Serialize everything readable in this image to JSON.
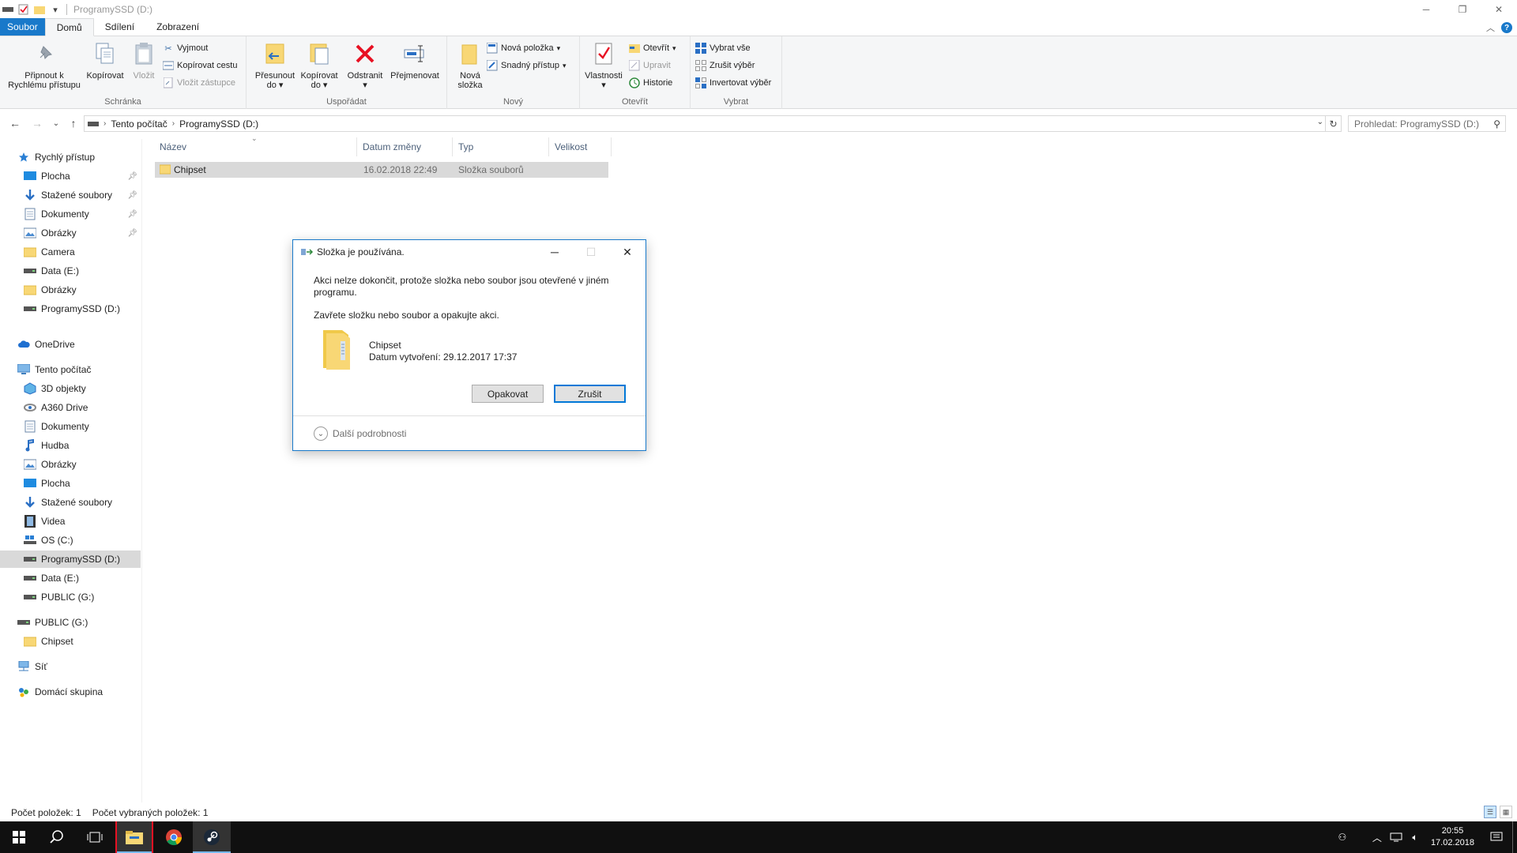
{
  "window": {
    "title": "ProgramySSD (D:)"
  },
  "tabs": [
    {
      "label": "Soubor"
    },
    {
      "label": "Domů"
    },
    {
      "label": "Sdílení"
    },
    {
      "label": "Zobrazení"
    }
  ],
  "ribbon": {
    "pin_label_1": "Připnout k",
    "pin_label_2": "Rychlému přístupu",
    "copy": "Kopírovat",
    "paste": "Vložit",
    "cut": "Vyjmout",
    "copy_path": "Kopírovat cestu",
    "paste_shortcut": "Vložit zástupce",
    "group_clipboard": "Schránka",
    "move_1": "Přesunout",
    "move_2": "do",
    "copyto_1": "Kopírovat",
    "copyto_2": "do",
    "delete": "Odstranit",
    "rename": "Přejmenovat",
    "group_organize": "Uspořádat",
    "newfolder_1": "Nová",
    "newfolder_2": "složka",
    "new_item": "Nová položka",
    "easy_access": "Snadný přístup",
    "group_new": "Nový",
    "properties": "Vlastnosti",
    "open": "Otevřít",
    "edit": "Upravit",
    "history": "Historie",
    "group_open": "Otevřít",
    "select_all": "Vybrat vše",
    "select_none": "Zrušit výběr",
    "invert": "Invertovat výběr",
    "group_select": "Vybrat"
  },
  "address": {
    "crumbs": [
      "Tento počítač",
      "ProgramySSD (D:)"
    ],
    "search_placeholder": "Prohledat: ProgramySSD (D:)"
  },
  "nav": {
    "quick_access": "Rychlý přístup",
    "qa_items": [
      "Plocha",
      "Stažené soubory",
      "Dokumenty",
      "Obrázky",
      "Camera",
      "Data (E:)",
      "Obrázky",
      "ProgramySSD (D:)"
    ],
    "onedrive": "OneDrive",
    "this_pc": "Tento počítač",
    "pc_items": [
      "3D objekty",
      "A360 Drive",
      "Dokumenty",
      "Hudba",
      "Obrázky",
      "Plocha",
      "Stažené soubory",
      "Videa",
      "OS (C:)",
      "ProgramySSD (D:)",
      "Data (E:)",
      "PUBLIC (G:)"
    ],
    "public": "PUBLIC (G:)",
    "public_items": [
      "Chipset"
    ],
    "network": "Síť",
    "homegroup": "Domácí skupina"
  },
  "columns": [
    "Název",
    "Datum změny",
    "Typ",
    "Velikost"
  ],
  "rows": [
    {
      "name": "Chipset",
      "date": "16.02.2018 22:49",
      "type": "Složka souborů",
      "size": ""
    }
  ],
  "status": {
    "count": "Počet položek: 1",
    "selected": "Počet vybraných položek: 1"
  },
  "dialog": {
    "title": "Složka je používána.",
    "message": "Akci nelze dokončit, protože složka nebo soubor jsou otevřené v jiném programu.",
    "instruction": "Zavřete složku nebo soubor a opakujte akci.",
    "file_name": "Chipset",
    "file_date": "Datum vytvoření: 29.12.2017 17:37",
    "retry": "Opakovat",
    "cancel": "Zrušit",
    "more": "Další podrobnosti"
  },
  "taskbar": {
    "time": "20:55",
    "date": "17.02.2018"
  },
  "colors": {
    "accent": "#1979ca",
    "folder": "#f8d775",
    "delete_red": "#e81123"
  }
}
